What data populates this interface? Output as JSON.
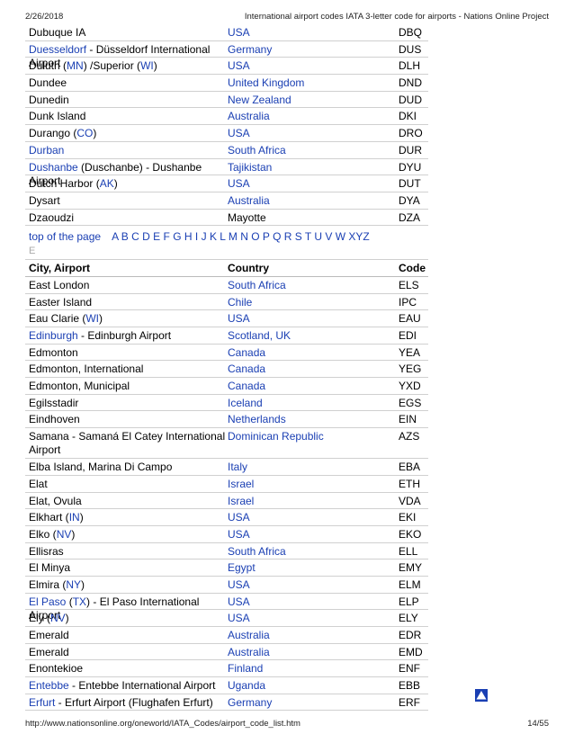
{
  "header": {
    "date": "2/26/2018",
    "title": "International airport codes IATA 3-letter code for airports - Nations Online Project"
  },
  "footer": {
    "url": "http://www.nationsonline.org/oneworld/IATA_Codes/airport_code_list.htm",
    "page": "14/55"
  },
  "rows_top": [
    {
      "city": [
        {
          "t": "Dubuque IA",
          "l": false
        }
      ],
      "country": "USA",
      "country_link": true,
      "code": "DBQ"
    },
    {
      "city": [
        {
          "t": "Duesseldorf",
          "l": true
        },
        {
          "t": " - Düsseldorf International Airport",
          "l": false
        }
      ],
      "country": "Germany",
      "country_link": true,
      "code": "DUS"
    },
    {
      "city": [
        {
          "t": "Duluth (",
          "l": false
        },
        {
          "t": "MN",
          "l": true
        },
        {
          "t": ") /Superior (",
          "l": false
        },
        {
          "t": "WI",
          "l": true
        },
        {
          "t": ")",
          "l": false
        }
      ],
      "country": "USA",
      "country_link": true,
      "code": "DLH"
    },
    {
      "city": [
        {
          "t": "Dundee",
          "l": false
        }
      ],
      "country": "United Kingdom",
      "country_link": true,
      "code": "DND"
    },
    {
      "city": [
        {
          "t": "Dunedin",
          "l": false
        }
      ],
      "country": "New Zealand",
      "country_link": true,
      "code": "DUD"
    },
    {
      "city": [
        {
          "t": "Dunk Island",
          "l": false
        }
      ],
      "country": "Australia",
      "country_link": true,
      "code": "DKI"
    },
    {
      "city": [
        {
          "t": "Durango (",
          "l": false
        },
        {
          "t": "CO",
          "l": true
        },
        {
          "t": ")",
          "l": false
        }
      ],
      "country": "USA",
      "country_link": true,
      "code": "DRO"
    },
    {
      "city": [
        {
          "t": "Durban",
          "l": true
        }
      ],
      "country": "South Africa",
      "country_link": true,
      "code": "DUR"
    },
    {
      "city": [
        {
          "t": "Dushanbe",
          "l": true
        },
        {
          "t": " (Duschanbe) - Dushanbe Airport",
          "l": false
        }
      ],
      "country": "Tajikistan",
      "country_link": true,
      "code": "DYU"
    },
    {
      "city": [
        {
          "t": "Dutch Harbor (",
          "l": false
        },
        {
          "t": "AK",
          "l": true
        },
        {
          "t": ")",
          "l": false
        }
      ],
      "country": "USA",
      "country_link": true,
      "code": "DUT"
    },
    {
      "city": [
        {
          "t": "Dysart",
          "l": false
        }
      ],
      "country": "Australia",
      "country_link": true,
      "code": "DYA"
    },
    {
      "city": [
        {
          "t": "Dzaoudzi",
          "l": false
        }
      ],
      "country": "Mayotte",
      "country_link": false,
      "code": "DZA"
    }
  ],
  "nav": {
    "top_label": "top of the page",
    "letters": [
      "A",
      "B",
      "C",
      "D",
      "E",
      "F",
      "G",
      "H",
      "I",
      "J",
      "K",
      "L",
      "M",
      "N",
      "O",
      "P",
      "Q",
      "R",
      "S",
      "T",
      "U",
      "V",
      "W",
      "XYZ"
    ]
  },
  "section": {
    "letter": "E",
    "headers": {
      "city": "City, Airport",
      "country": "Country",
      "code": "Code"
    }
  },
  "rows_e": [
    {
      "city": [
        {
          "t": "East London",
          "l": false
        }
      ],
      "country": "South Africa",
      "country_link": true,
      "code": "ELS"
    },
    {
      "city": [
        {
          "t": "Easter Island",
          "l": false
        }
      ],
      "country": "Chile",
      "country_link": true,
      "code": "IPC"
    },
    {
      "city": [
        {
          "t": "Eau Clarie (",
          "l": false
        },
        {
          "t": "WI",
          "l": true
        },
        {
          "t": ")",
          "l": false
        }
      ],
      "country": "USA",
      "country_link": true,
      "code": "EAU"
    },
    {
      "city": [
        {
          "t": "Edinburgh",
          "l": true
        },
        {
          "t": " - Edinburgh Airport",
          "l": false
        }
      ],
      "country": "Scotland, UK",
      "country_link": true,
      "code": "EDI"
    },
    {
      "city": [
        {
          "t": "Edmonton",
          "l": false
        }
      ],
      "country": "Canada",
      "country_link": true,
      "code": "YEA"
    },
    {
      "city": [
        {
          "t": "Edmonton, International",
          "l": false
        }
      ],
      "country": "Canada",
      "country_link": true,
      "code": "YEG"
    },
    {
      "city": [
        {
          "t": "Edmonton, Municipal",
          "l": false
        }
      ],
      "country": "Canada",
      "country_link": true,
      "code": "YXD"
    },
    {
      "city": [
        {
          "t": "Egilsstadir",
          "l": false
        }
      ],
      "country": "Iceland",
      "country_link": true,
      "code": "EGS"
    },
    {
      "city": [
        {
          "t": "Eindhoven",
          "l": false
        }
      ],
      "country": "Netherlands",
      "country_link": true,
      "code": "EIN"
    },
    {
      "city": [
        {
          "t": "Samana - Samaná El Catey International Airport",
          "l": false
        }
      ],
      "country": "Dominican Republic",
      "country_link": true,
      "code": "AZS",
      "tall": true
    },
    {
      "city": [
        {
          "t": "Elba Island, Marina Di Campo",
          "l": false
        }
      ],
      "country": "Italy",
      "country_link": true,
      "code": "EBA"
    },
    {
      "city": [
        {
          "t": "Elat",
          "l": false
        }
      ],
      "country": "Israel",
      "country_link": true,
      "code": "ETH"
    },
    {
      "city": [
        {
          "t": "Elat, Ovula",
          "l": false
        }
      ],
      "country": "Israel",
      "country_link": true,
      "code": "VDA"
    },
    {
      "city": [
        {
          "t": "Elkhart (",
          "l": false
        },
        {
          "t": "IN",
          "l": true
        },
        {
          "t": ")",
          "l": false
        }
      ],
      "country": "USA",
      "country_link": true,
      "code": "EKI"
    },
    {
      "city": [
        {
          "t": "Elko (",
          "l": false
        },
        {
          "t": "NV",
          "l": true
        },
        {
          "t": ")",
          "l": false
        }
      ],
      "country": "USA",
      "country_link": true,
      "code": "EKO"
    },
    {
      "city": [
        {
          "t": "Ellisras",
          "l": false
        }
      ],
      "country": "South Africa",
      "country_link": true,
      "code": "ELL"
    },
    {
      "city": [
        {
          "t": "El Minya",
          "l": false
        }
      ],
      "country": "Egypt",
      "country_link": true,
      "code": "EMY"
    },
    {
      "city": [
        {
          "t": "Elmira (",
          "l": false
        },
        {
          "t": "NY",
          "l": true
        },
        {
          "t": ")",
          "l": false
        }
      ],
      "country": "USA",
      "country_link": true,
      "code": "ELM"
    },
    {
      "city": [
        {
          "t": "El Paso",
          "l": true
        },
        {
          "t": " (",
          "l": false
        },
        {
          "t": "TX",
          "l": true
        },
        {
          "t": ") - El Paso International Airport",
          "l": false
        }
      ],
      "country": "USA",
      "country_link": true,
      "code": "ELP"
    },
    {
      "city": [
        {
          "t": "Ely (",
          "l": false
        },
        {
          "t": "NV",
          "l": true
        },
        {
          "t": ")",
          "l": false
        }
      ],
      "country": "USA",
      "country_link": true,
      "code": "ELY"
    },
    {
      "city": [
        {
          "t": "Emerald",
          "l": false
        }
      ],
      "country": "Australia",
      "country_link": true,
      "code": "EDR"
    },
    {
      "city": [
        {
          "t": "Emerald",
          "l": false
        }
      ],
      "country": "Australia",
      "country_link": true,
      "code": "EMD"
    },
    {
      "city": [
        {
          "t": "Enontekioe",
          "l": false
        }
      ],
      "country": "Finland",
      "country_link": true,
      "code": "ENF"
    },
    {
      "city": [
        {
          "t": "Entebbe",
          "l": true
        },
        {
          "t": " - Entebbe International Airport",
          "l": false
        }
      ],
      "country": "Uganda",
      "country_link": true,
      "code": "EBB"
    },
    {
      "city": [
        {
          "t": "Erfurt",
          "l": true
        },
        {
          "t": " - Erfurt Airport (Flughafen Erfurt)",
          "l": false
        }
      ],
      "country": "Germany",
      "country_link": true,
      "code": "ERF"
    }
  ],
  "icons": {
    "back_to_top": "arrow-up-icon"
  },
  "colors": {
    "link": "#1a3fb3",
    "section_letter": "#aaaaaa",
    "row_border": "#d0d0d0"
  }
}
